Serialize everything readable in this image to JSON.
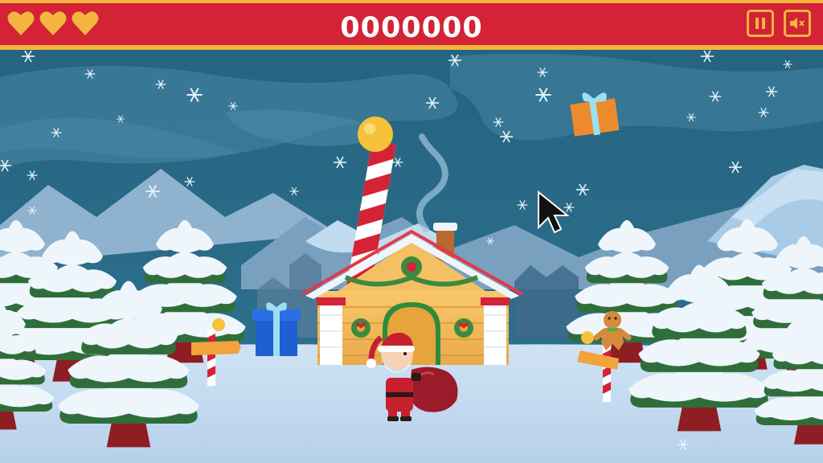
{
  "hud": {
    "score": "0000000",
    "lives": 3,
    "pause_icon": "pause-icon",
    "mute_icon": "speaker-muted-icon"
  },
  "colors": {
    "bar_red": "#d42336",
    "gold": "#f4b53f",
    "sky": "#2c6a88",
    "snow": "#eef6fb"
  }
}
